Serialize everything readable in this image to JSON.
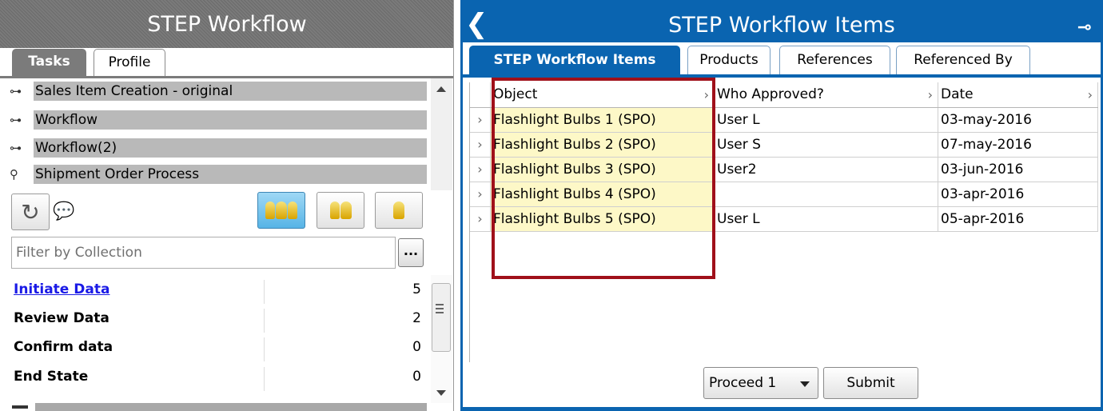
{
  "left_panel": {
    "title": "STEP Workflow",
    "tabs": [
      {
        "label": "Tasks",
        "active": true
      },
      {
        "label": "Profile",
        "active": false
      }
    ],
    "workflows": [
      {
        "label": "Sales Item Creation - original",
        "icon": "collapsed-node-icon"
      },
      {
        "label": "Workflow",
        "icon": "collapsed-node-icon"
      },
      {
        "label": "Workflow(2)",
        "icon": "collapsed-node-icon"
      },
      {
        "label": "Shipment Order Process",
        "icon": "expanded-node-icon"
      }
    ],
    "toolbar": {
      "refresh_icon": "refresh-icon",
      "comment_icon": "comment-icon",
      "buttons": [
        "group-tasks-icon",
        "group-users-icon",
        "single-user-icon"
      ]
    },
    "filter": {
      "placeholder": "Filter by Collection",
      "button_label": "..."
    },
    "states": [
      {
        "name": "Initiate Data",
        "count": "5",
        "link": true
      },
      {
        "name": "Review Data",
        "count": "2",
        "link": false
      },
      {
        "name": "Confirm data",
        "count": "0",
        "link": false
      },
      {
        "name": "End State",
        "count": "0",
        "link": false
      }
    ]
  },
  "right_panel": {
    "title": "STEP Workflow Items",
    "tabs": [
      {
        "label": "STEP Workflow Items",
        "active": true
      },
      {
        "label": "Products",
        "active": false
      },
      {
        "label": "References",
        "active": false
      },
      {
        "label": "Referenced By",
        "active": false
      }
    ],
    "grid": {
      "columns": [
        "Object",
        "Who Approved?",
        "Date"
      ],
      "rows": [
        {
          "object": "Flashlight Bulbs 1 (SPO)",
          "who": "User L",
          "date": "03-may-2016"
        },
        {
          "object": "Flashlight Bulbs 2 (SPO)",
          "who": "User S",
          "date": "07-may-2016"
        },
        {
          "object": "Flashlight Bulbs 3 (SPO)",
          "who": "User2",
          "date": "03-jun-2016"
        },
        {
          "object": "Flashlight Bulbs 4 (SPO)",
          "who": "",
          "date": "03-apr-2016"
        },
        {
          "object": "Flashlight Bulbs 5 (SPO)",
          "who": "User L",
          "date": "05-apr-2016"
        }
      ]
    },
    "actions": {
      "proceed_label": "Proceed 1",
      "submit_label": "Submit"
    },
    "colors": {
      "accent": "#0a64b0",
      "highlight_border": "#a0101a",
      "object_cell": "#fdf8c7"
    }
  }
}
